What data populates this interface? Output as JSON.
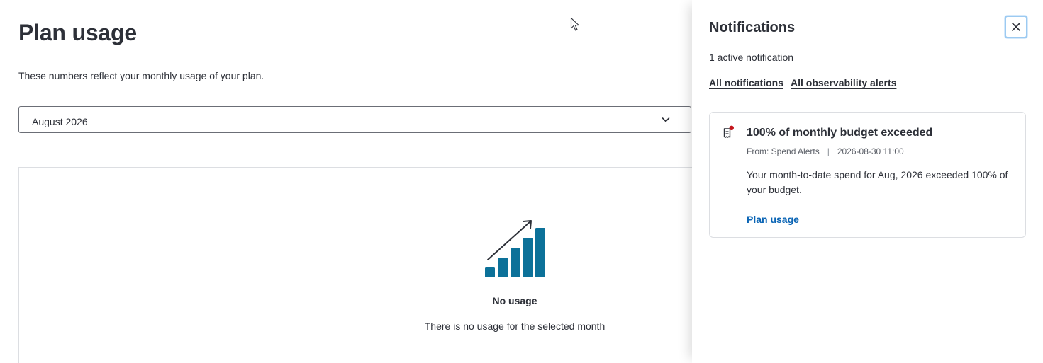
{
  "main": {
    "title": "Plan usage",
    "description": "These numbers reflect your monthly usage of your plan.",
    "month_select": {
      "value": "August 2026",
      "icon": "chevron-down-icon"
    },
    "empty_state": {
      "icon": "bar-chart-growth-icon",
      "title": "No usage",
      "text": "There is no usage for the selected month"
    }
  },
  "notifications": {
    "title": "Notifications",
    "active_count": "1 active notification",
    "tabs": [
      {
        "label": "All notifications"
      },
      {
        "label": "All observability alerts"
      }
    ],
    "items": [
      {
        "icon": "receipt-alert-icon",
        "title": "100% of monthly budget exceeded",
        "from": "From: Spend Alerts",
        "separator": "|",
        "timestamp": "2026-08-30 11:00",
        "body": "Your month-to-date spend for Aug, 2026 exceeded 100% of your budget.",
        "link": "Plan usage"
      }
    ]
  },
  "colors": {
    "accent_blue": "#0b65b5",
    "chart_teal": "#0c7199",
    "alert_red": "#c4161c",
    "focus_ring": "#9ccaf1"
  }
}
